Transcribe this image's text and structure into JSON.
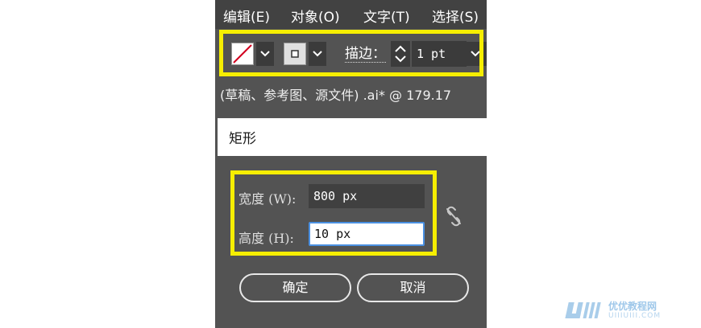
{
  "menu": {
    "items": [
      {
        "label": "编辑(E)"
      },
      {
        "label": "对象(O)"
      },
      {
        "label": "文字(T)"
      },
      {
        "label": "选择(S)"
      }
    ]
  },
  "toolbar": {
    "stroke_label": "描边：",
    "stroke_value": "1 pt"
  },
  "document": {
    "title": "(草稿、参考图、源文件) .ai* @ 179.17"
  },
  "dialog": {
    "title": "矩形",
    "width_label": "宽度 (W):",
    "width_value": "800 px",
    "height_label": "高度 (H):",
    "height_value": "10 px",
    "ok_label": "确定",
    "cancel_label": "取消"
  },
  "watermark": {
    "brand": "UiiiUiii",
    "text": "优优教程网",
    "url": "UIIIUIII.COM"
  },
  "colors": {
    "highlight": "#f6ee00",
    "panel": "#535353",
    "menubar": "#424242",
    "input_focus": "#4a90e2"
  }
}
